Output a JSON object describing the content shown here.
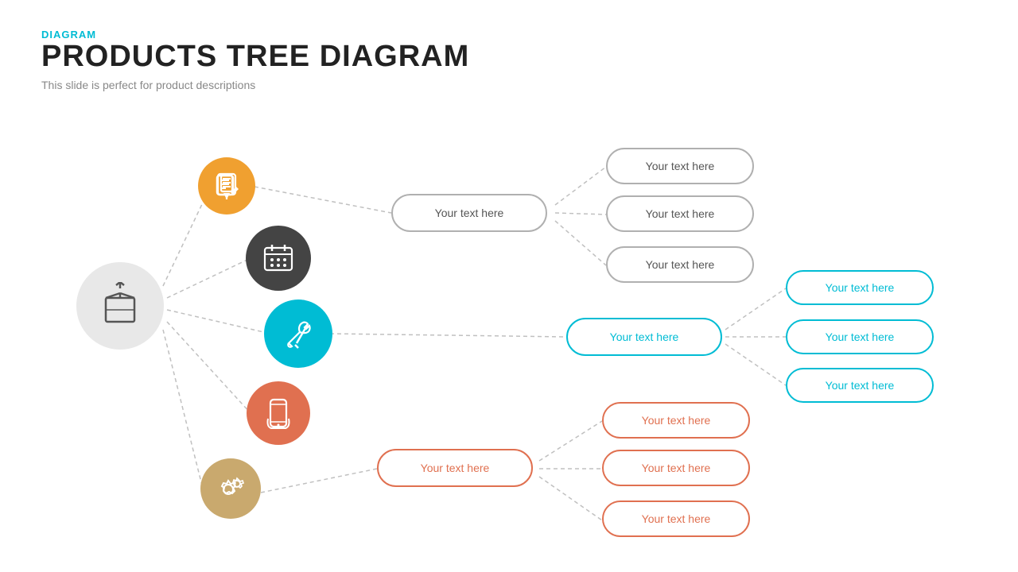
{
  "header": {
    "label": "DIAGRAM",
    "title": "PRODUCTS TREE DIAGRAM",
    "subtitle": "This slide is perfect for product descriptions"
  },
  "colors": {
    "teal": "#00bcd4",
    "orange": "#e07050",
    "dark": "#444444",
    "tan": "#c9a96e",
    "gray": "#e0e0e0",
    "line": "#b0b0b0"
  },
  "branches": [
    {
      "id": "branch1",
      "color": "#f0a030",
      "icon": "pencil"
    },
    {
      "id": "branch2",
      "color": "#444444",
      "icon": "calendar"
    },
    {
      "id": "branch3",
      "color": "#00bcd4",
      "icon": "tools"
    },
    {
      "id": "branch4",
      "color": "#e07050",
      "icon": "phone"
    },
    {
      "id": "branch5",
      "color": "#c9a96e",
      "icon": "gear"
    }
  ],
  "nodes": {
    "top_mid": "Your text here",
    "teal_mid": "Your text here",
    "bottom_mid": "Your text here",
    "gray1": "Your text here",
    "gray2": "Your text here",
    "gray3": "Your text here",
    "teal1": "Your text here",
    "teal2": "Your text here",
    "teal3": "Your text here",
    "orange1": "Your text here",
    "orange2": "Your text here",
    "orange3": "Your text here"
  }
}
